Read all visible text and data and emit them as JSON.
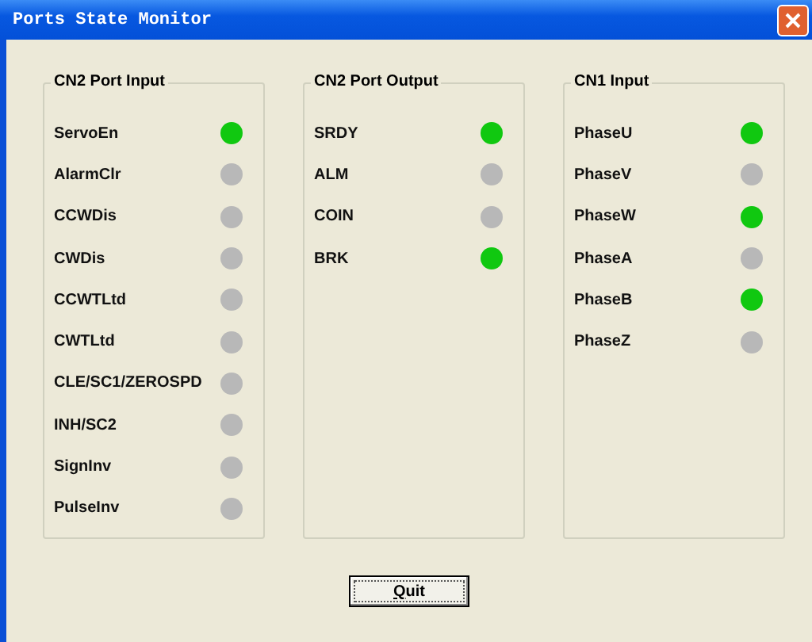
{
  "window": {
    "title": "Ports State Monitor"
  },
  "groups": [
    {
      "title": "CN2 Port Input",
      "signals": [
        {
          "name": "ServoEn",
          "on": true
        },
        {
          "name": "AlarmClr",
          "on": false
        },
        {
          "name": "CCWDis",
          "on": false
        },
        {
          "name": "CWDis",
          "on": false
        },
        {
          "name": "CCWTLtd",
          "on": false
        },
        {
          "name": "CWTLtd",
          "on": false
        },
        {
          "name": "CLE/SC1/ZEROSPD",
          "on": false
        },
        {
          "name": "INH/SC2",
          "on": false
        },
        {
          "name": "SignInv",
          "on": false
        },
        {
          "name": "PulseInv",
          "on": false
        }
      ]
    },
    {
      "title": "CN2 Port Output",
      "signals": [
        {
          "name": "SRDY",
          "on": true
        },
        {
          "name": "ALM",
          "on": false
        },
        {
          "name": "COIN",
          "on": false
        },
        {
          "name": "BRK",
          "on": true
        }
      ]
    },
    {
      "title": "CN1 Input",
      "signals": [
        {
          "name": "PhaseU",
          "on": true
        },
        {
          "name": "PhaseV",
          "on": false
        },
        {
          "name": "PhaseW",
          "on": true
        },
        {
          "name": "PhaseA",
          "on": false
        },
        {
          "name": "PhaseB",
          "on": true
        },
        {
          "name": "PhaseZ",
          "on": false
        }
      ]
    }
  ],
  "buttons": [
    {
      "label": "Quit"
    }
  ]
}
